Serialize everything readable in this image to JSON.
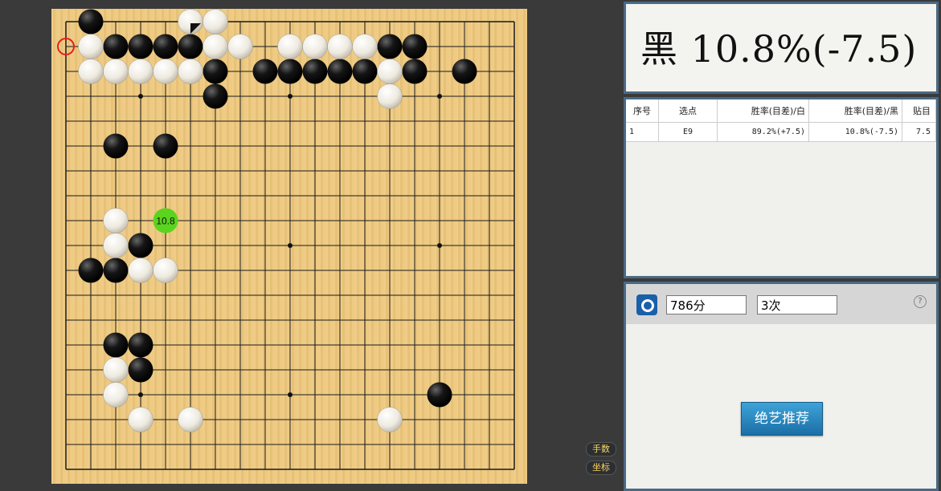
{
  "board": {
    "size": 19,
    "black_stones": [
      [
        1,
        0
      ],
      [
        2,
        1
      ],
      [
        3,
        1
      ],
      [
        4,
        1
      ],
      [
        5,
        1
      ],
      [
        13,
        1
      ],
      [
        14,
        1
      ],
      [
        6,
        2
      ],
      [
        8,
        2
      ],
      [
        9,
        2
      ],
      [
        10,
        2
      ],
      [
        11,
        2
      ],
      [
        12,
        2
      ],
      [
        14,
        2
      ],
      [
        16,
        2
      ],
      [
        6,
        3
      ],
      [
        2,
        5
      ],
      [
        4,
        5
      ],
      [
        3,
        9
      ],
      [
        1,
        10
      ],
      [
        2,
        10
      ],
      [
        2,
        13
      ],
      [
        3,
        13
      ],
      [
        3,
        14
      ],
      [
        15,
        15
      ]
    ],
    "white_stones": [
      [
        5,
        0
      ],
      [
        6,
        0
      ],
      [
        1,
        1
      ],
      [
        6,
        1
      ],
      [
        7,
        1
      ],
      [
        9,
        1
      ],
      [
        10,
        1
      ],
      [
        11,
        1
      ],
      [
        12,
        1
      ],
      [
        1,
        2
      ],
      [
        2,
        2
      ],
      [
        3,
        2
      ],
      [
        4,
        2
      ],
      [
        5,
        2
      ],
      [
        13,
        2
      ],
      [
        13,
        3
      ],
      [
        2,
        8
      ],
      [
        2,
        9
      ],
      [
        3,
        10
      ],
      [
        4,
        10
      ],
      [
        2,
        14
      ],
      [
        2,
        15
      ],
      [
        3,
        16
      ],
      [
        5,
        16
      ],
      [
        13,
        16
      ]
    ],
    "star_points": [
      [
        3,
        3
      ],
      [
        9,
        3
      ],
      [
        15,
        3
      ],
      [
        3,
        9
      ],
      [
        9,
        9
      ],
      [
        15,
        9
      ],
      [
        3,
        15
      ],
      [
        9,
        15
      ],
      [
        15,
        15
      ]
    ],
    "last_move": [
      5,
      0
    ],
    "red_marker": [
      0,
      1
    ],
    "suggestion": {
      "point": [
        4,
        8
      ],
      "label": "10.8",
      "color": "#5ad41e"
    }
  },
  "side_buttons": {
    "move_number": "手数",
    "coordinates": "坐标"
  },
  "winrate_header": {
    "text": "黑  10.8%(-7.5)"
  },
  "analysis_table": {
    "columns": [
      "序号",
      "选点",
      "胜率(目差)/白",
      "胜率(目差)/黑",
      "贴目"
    ],
    "rows": [
      [
        "1",
        "E9",
        "89.2%(+7.5)",
        "10.8%(-7.5)",
        "7.5"
      ]
    ]
  },
  "engine": {
    "score": "786分",
    "count": "3次",
    "help_icon": "?",
    "recommend_button": "绝艺推荐"
  },
  "colors": {
    "panel_border": "#4a6a84",
    "button": "#1a7fb8"
  }
}
